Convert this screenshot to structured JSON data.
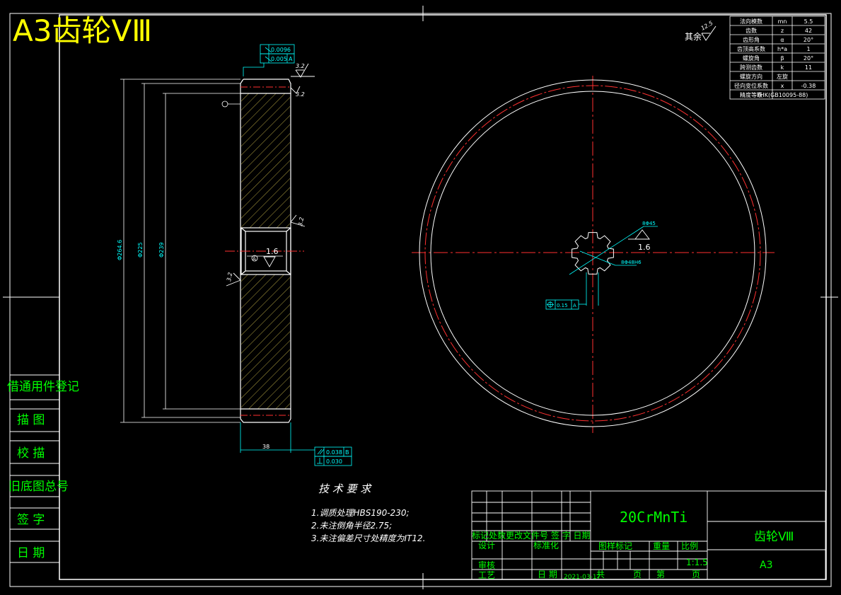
{
  "title": "A3齿轮ⅤⅢ",
  "roughness_other": {
    "label": "其余",
    "value": "12.5"
  },
  "params_table": [
    {
      "name": "法向模数",
      "symbol": "mn",
      "value": "5.5"
    },
    {
      "name": "齿数",
      "symbol": "z",
      "value": "42"
    },
    {
      "name": "齿形角",
      "symbol": "α",
      "value": "20°"
    },
    {
      "name": "齿顶高系数",
      "symbol": "h*a",
      "value": "1"
    },
    {
      "name": "螺旋角",
      "symbol": "β",
      "value": "20°"
    },
    {
      "name": "跨测齿数",
      "symbol": "k",
      "value": "11"
    },
    {
      "name": "螺旋方向",
      "symbol": "",
      "value": "左旋"
    },
    {
      "name": "径向变位系数",
      "symbol": "x",
      "value": "-0.38"
    },
    {
      "name": "精度等级",
      "symbol": "",
      "value": "7HK(GB10095-88)"
    }
  ],
  "side_labels": [
    "借通用件登记",
    "描 图",
    "校 描",
    "旧底图总号",
    "签 字",
    "日 期"
  ],
  "section_view": {
    "dia_outer": "Φ264.6",
    "dia_root": "Φ225",
    "dia_hub": "Φ239",
    "width": "38",
    "runout_top": "0.0096",
    "parallel_top": "0.005",
    "datum_top": "A",
    "runout_bot": "0.038",
    "datum_bot": "B",
    "parallel_bot": "0.030",
    "datum_a": "A",
    "r_top": "3.2",
    "r_top2": "3.2",
    "r_right": "3.2",
    "r_left": "3.2",
    "r_bore": "1.6"
  },
  "front_view": {
    "spline": "8Φ45",
    "spline2": "8Φ48H6",
    "roughness": "1.6",
    "position_tol": "0.15",
    "position_datum": "A"
  },
  "tech_req": {
    "heading": "技 术 要 求",
    "items": [
      "1.调质处理HBS190-230;",
      "2.未注倒角半径2.75;",
      "3.未注偏差尺寸处精度为IT12."
    ]
  },
  "title_block": {
    "material": "20CrMnTi",
    "part_name": "齿轮Ⅷ",
    "sheet_size": "A3",
    "rev_header": "标记处数更改文件号 签 字 日期",
    "design": "设计",
    "standardize": "标准化",
    "check": "审核",
    "process": "工艺",
    "date_label": "日 期",
    "date_value": "2021-03-17",
    "stage_label": "图样标记",
    "weight_label": "重量",
    "scale_label": "比例",
    "scale_value": "1:1.5",
    "total_label": "共",
    "page_label": "页",
    "sheet_label": "第",
    "sheet_page": "页"
  },
  "colors": {
    "line": "#ffffff",
    "dim": "#00ffff",
    "centerline": "#ff3030",
    "title": "#ffff00",
    "green": "#00ff00",
    "hatch": "#b0a040"
  }
}
